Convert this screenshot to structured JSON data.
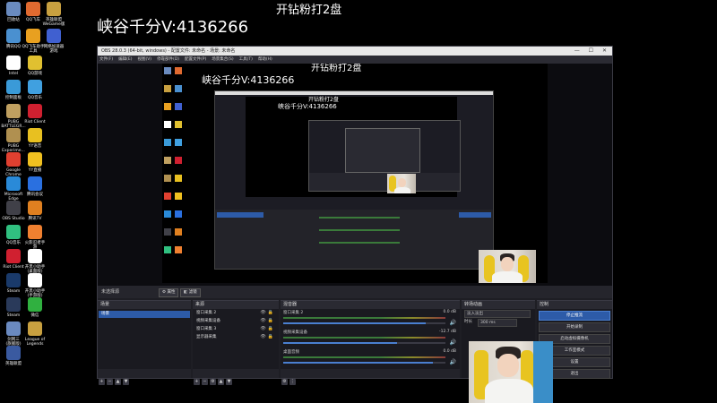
{
  "overlay": {
    "top_text": "开钻粉打2盘",
    "main_text": "峡谷千分V:4136266"
  },
  "desktop_icons": [
    {
      "label": "回收站",
      "color": "#6a8bbf"
    },
    {
      "label": "QQ飞车",
      "color": "#e06a30"
    },
    {
      "label": "英雄联盟\nWeGame版",
      "color": "#c8a040"
    },
    {
      "label": "腾讯QQ",
      "color": "#4a90d0"
    },
    {
      "label": "QQ飞车助手\n工具",
      "color": "#e8a020"
    },
    {
      "label": "网络加速器\n游戏",
      "color": "#4060d0"
    },
    {
      "label": "Intel",
      "color": "#ffffff"
    },
    {
      "label": "QQ游戏",
      "color": "#e0c030"
    },
    {
      "label": "控制面板",
      "color": "#3a9ad8"
    },
    {
      "label": "QQ音乐",
      "color": "#40a0e0"
    },
    {
      "label": "PUBG\nBATTLEGR...",
      "color": "#c0a060"
    },
    {
      "label": "Riot Client",
      "color": "#d02030"
    },
    {
      "label": "PUBG\nExperime...",
      "color": "#b09050"
    },
    {
      "label": "YY语音",
      "color": "#e8c020"
    },
    {
      "label": "Google\nChrome",
      "color": "#e04030"
    },
    {
      "label": "YY直播",
      "color": "#f0c020"
    },
    {
      "label": "Microsoft\nEdge",
      "color": "#2a8ad8"
    },
    {
      "label": "腾讯会议",
      "color": "#2a70e0"
    },
    {
      "label": "OBS Studio",
      "color": "#404048"
    },
    {
      "label": "腾讯TV",
      "color": "#e08020"
    },
    {
      "label": "QQ音乐",
      "color": "#30c080"
    },
    {
      "label": "火影忍者手\n游",
      "color": "#f08030"
    },
    {
      "label": "Riot Client",
      "color": "#d02030"
    },
    {
      "label": "开黑小助手\n(桌面版)",
      "color": "#ffffff"
    },
    {
      "label": "Steam",
      "color": "#1a3a6a"
    },
    {
      "label": "开黑小助手\n(手游版)",
      "color": "#ffffff"
    },
    {
      "label": "Steam",
      "color": "#2a3a5a"
    },
    {
      "label": "微信",
      "color": "#30b040"
    },
    {
      "label": "剑网三\n(旗舰版)",
      "color": "#6a8ac0"
    },
    {
      "label": "League of\nLegends",
      "color": "#c8a040"
    },
    {
      "label": "英雄联盟",
      "color": "#3a5aa0"
    }
  ],
  "obs": {
    "window_title": "OBS 28.0.3 (64-bit, windows) - 配置文件: 未命名 - 场景: 未命名",
    "window_controls": "— ☐ ✕",
    "menu": [
      "文件(F)",
      "编辑(E)",
      "视图(V)",
      "停靠部件(D)",
      "配置文件(P)",
      "场景集合(S)",
      "工具(T)",
      "帮助(H)"
    ],
    "scene_bar": {
      "label": "未选择源",
      "properties": "属性",
      "filters": "滤镜"
    },
    "scenes": {
      "title": "场景",
      "items": [
        "场景"
      ]
    },
    "sources": {
      "title": "来源",
      "items": [
        "窗口采集 2",
        "视频采集设备",
        "窗口采集 3",
        "显示器采集"
      ]
    },
    "mixer": {
      "title": "混音器",
      "channels": [
        {
          "name": "窗口采集 2",
          "db": "0.0 dB",
          "level": 0.88
        },
        {
          "name": "视频采集设备",
          "db": "-12.7 dB",
          "level": 0.7
        },
        {
          "name": "桌面音频",
          "db": "0.0 dB",
          "level": 0.92
        }
      ]
    },
    "transitions": {
      "title": "转场动画",
      "type": "淡入淡出",
      "duration_label": "时长",
      "duration": "300 ms"
    },
    "controls": {
      "title": "控制",
      "buttons": [
        "停止推流",
        "开始录制",
        "启动虚拟摄像机",
        "工作室模式",
        "设置",
        "退出"
      ]
    }
  },
  "nested": {
    "main_text": "峡谷千分V:4136266",
    "top_text": "开钻粉打2盘",
    "main_text_2": "峡谷千分V:4136266",
    "top_text_2": "开钻粉打2盘"
  }
}
